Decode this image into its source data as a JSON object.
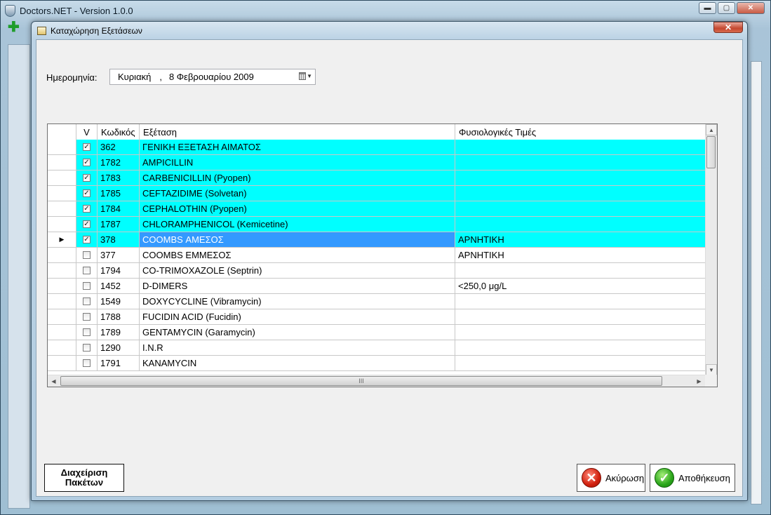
{
  "main_window": {
    "title": "Doctors.NET - Version 1.0.0",
    "controls": {
      "minimize": "▬",
      "maximize": "▢",
      "close": "✕"
    },
    "toolbar_add_icon": "plus-icon"
  },
  "dialog": {
    "title": "Καταχώρηση Εξετάσεων",
    "close_glyph": "✕"
  },
  "date": {
    "label": "Ημερομηνία:",
    "day": "Κυριακή",
    "separator": ",",
    "date_text": "8 Φεβρουαρίου 2009"
  },
  "grid": {
    "columns": {
      "v": "V",
      "code": "Κωδικός",
      "name": "Εξέταση",
      "normal": "Φυσιολογικές Τιμές"
    },
    "rows": [
      {
        "checked": true,
        "code": "362",
        "name": "ΓΕΝΙΚΗ ΕΞΕΤΑΣΗ ΑΙΜΑΤΟΣ",
        "normal": ""
      },
      {
        "checked": true,
        "code": "1782",
        "name": "AMPICILLIN",
        "normal": ""
      },
      {
        "checked": true,
        "code": "1783",
        "name": "CARBENICILLIN (Pyopen)",
        "normal": ""
      },
      {
        "checked": true,
        "code": "1785",
        "name": "CEFTAZIDIME (Solvetan)",
        "normal": ""
      },
      {
        "checked": true,
        "code": "1784",
        "name": "CEPHALOTHIN (Pyopen)",
        "normal": ""
      },
      {
        "checked": true,
        "code": "1787",
        "name": "CHLORAMPHENICOL (Kemicetine)",
        "normal": ""
      },
      {
        "checked": true,
        "code": "378",
        "name": "COOMBS ΑΜΕΣΟΣ",
        "normal": "ΑΡΝΗΤΙΚΗ",
        "current": true
      },
      {
        "checked": false,
        "code": "377",
        "name": "COOMBS ΕΜΜΕΣΟΣ",
        "normal": "ΑΡΝΗΤΙΚΗ"
      },
      {
        "checked": false,
        "code": "1794",
        "name": "CO-TRIMOXAZOLE (Septrin)",
        "normal": ""
      },
      {
        "checked": false,
        "code": "1452",
        "name": "D-DIMERS",
        "normal": "<250,0 μg/L"
      },
      {
        "checked": false,
        "code": "1549",
        "name": "DOXYCYCLINE (Vibramycin)",
        "normal": ""
      },
      {
        "checked": false,
        "code": "1788",
        "name": "FUCIDIN ACID (Fucidin)",
        "normal": ""
      },
      {
        "checked": false,
        "code": "1789",
        "name": "GENTAMYCIN (Garamycin)",
        "normal": ""
      },
      {
        "checked": false,
        "code": "1290",
        "name": "I.N.R",
        "normal": ""
      },
      {
        "checked": false,
        "code": "1791",
        "name": "KANAMYCIN",
        "normal": ""
      }
    ],
    "current_row_marker": "▶",
    "hscroll_grip": "III"
  },
  "buttons": {
    "packages_line1": "Διαχείριση",
    "packages_line2": "Πακέτων",
    "cancel": "Ακύρωση",
    "save": "Αποθήκευση"
  },
  "colors": {
    "checked_row": "#00ffff",
    "selected_cell": "#3399ff"
  }
}
